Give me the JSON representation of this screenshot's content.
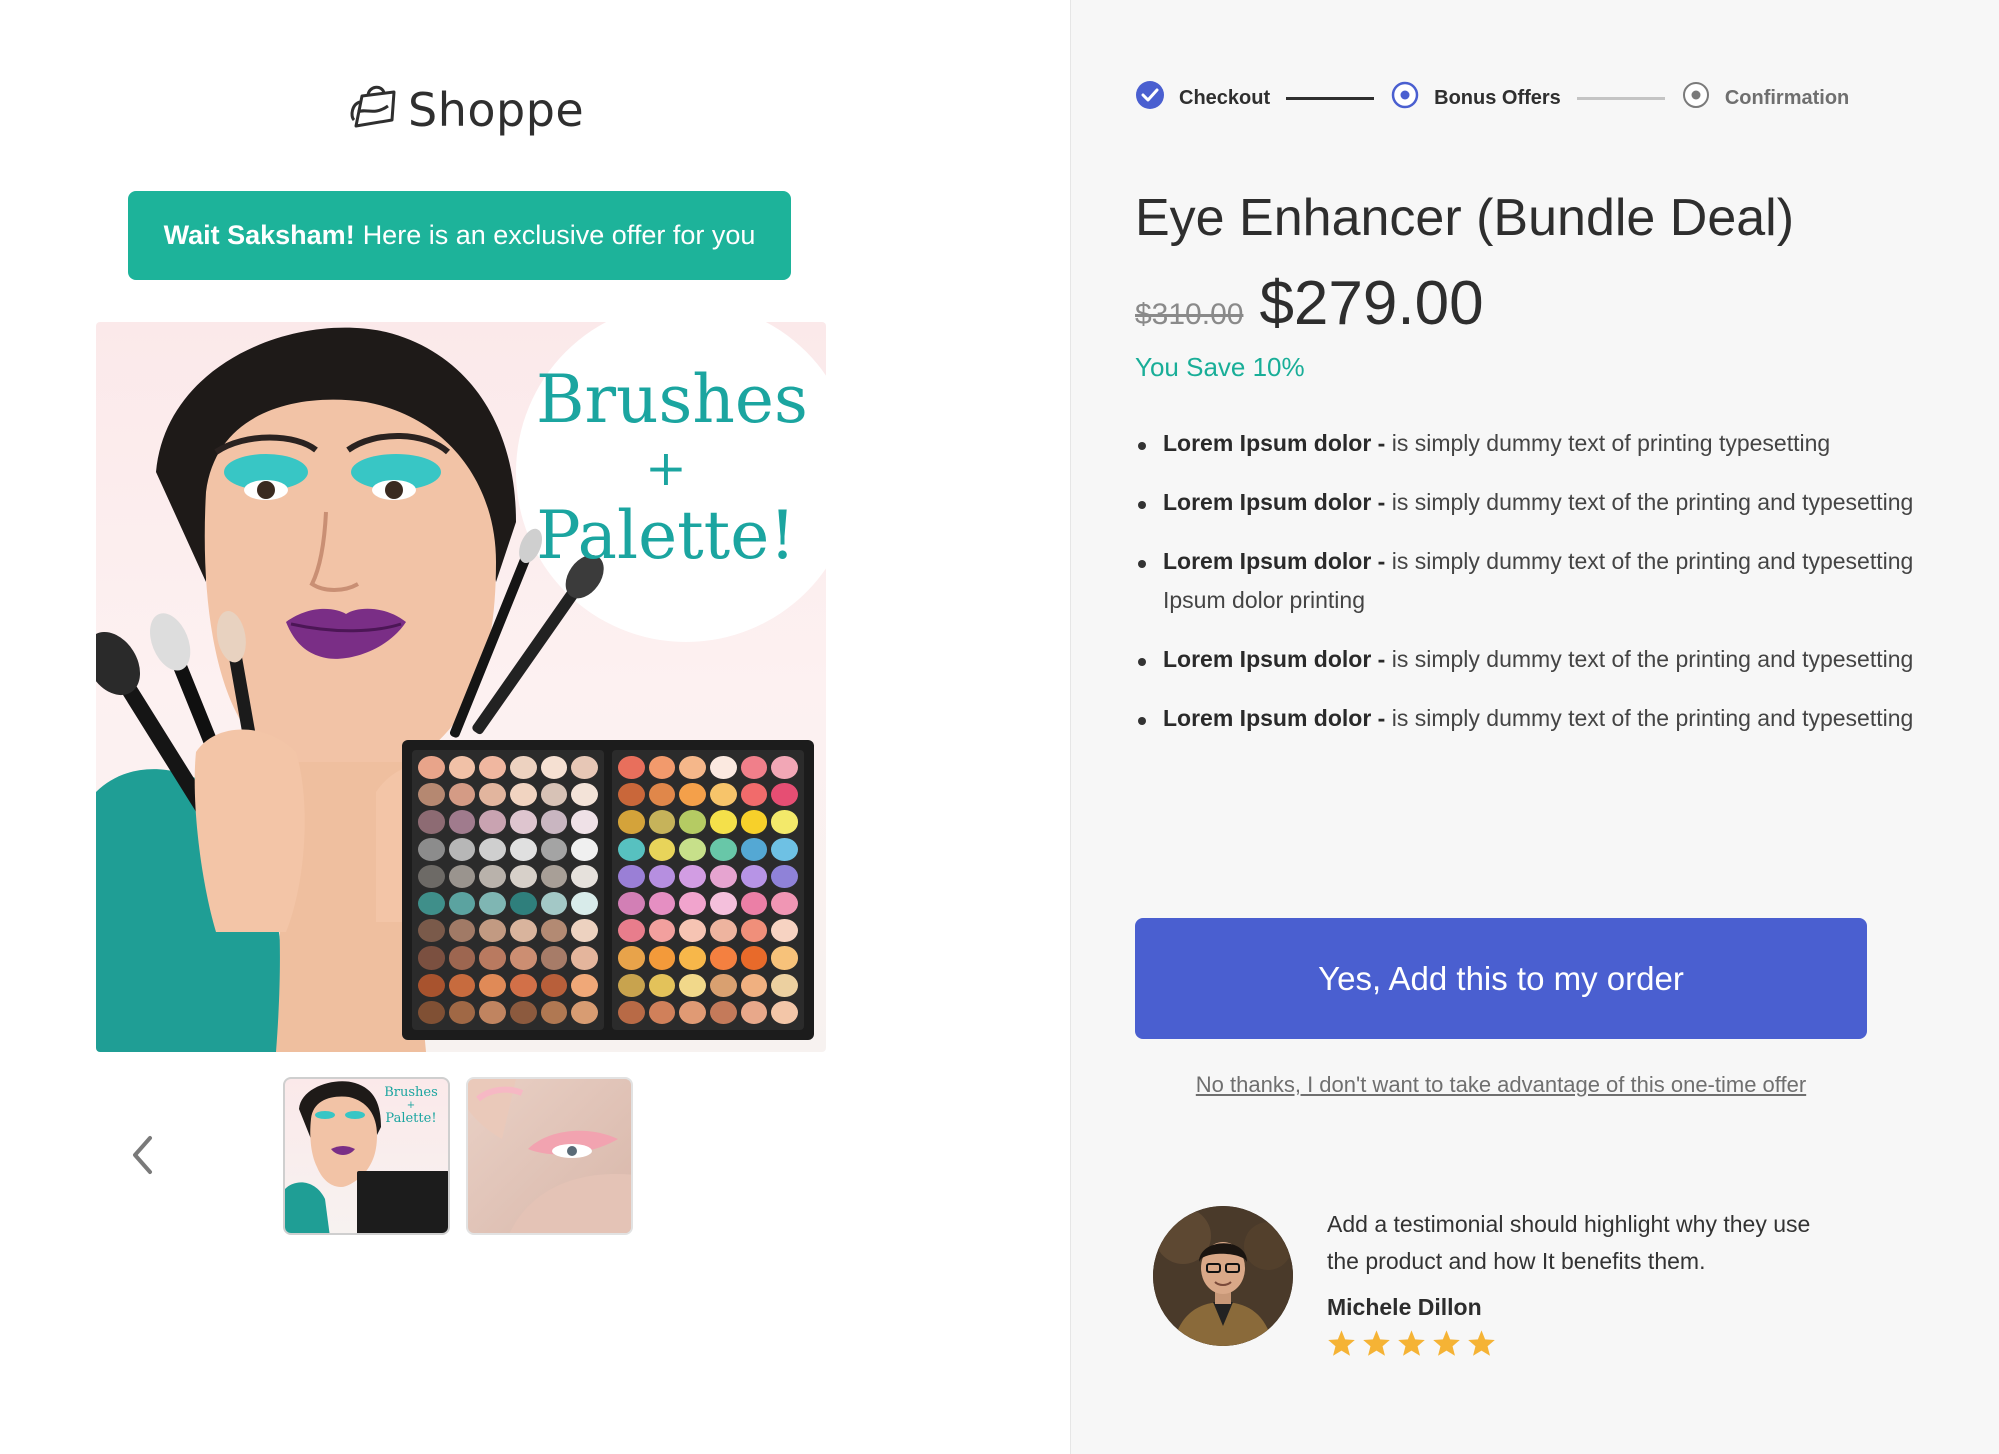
{
  "brand": {
    "name": "Shoppe",
    "icon": "shopping-bag-icon"
  },
  "banner": {
    "bold": "Wait Saksham!",
    "rest": "Here is an exclusive offer for you"
  },
  "hero": {
    "line1": "Brushes",
    "line2": "+",
    "line3": "Palette!"
  },
  "thumbnails": [
    {
      "line1": "Brushes",
      "line2": "+",
      "line3": "Palette!"
    },
    {}
  ],
  "steps": [
    {
      "label": "Checkout",
      "state": "done"
    },
    {
      "label": "Bonus Offers",
      "state": "current"
    },
    {
      "label": "Confirmation",
      "state": "upcoming"
    }
  ],
  "product": {
    "title": "Eye Enhancer (Bundle Deal)",
    "old_price": "$310.00",
    "new_price": "$279.00",
    "savings": "You Save 10%"
  },
  "features": [
    {
      "bold": "Lorem Ipsum dolor -",
      "text": " is simply dummy text of printing typesetting"
    },
    {
      "bold": "Lorem Ipsum dolor -",
      "text": " is simply dummy text of the printing and typesetting"
    },
    {
      "bold": "Lorem Ipsum dolor -",
      "text": " is simply dummy text of the printing and typesetting Ipsum dolor printing"
    },
    {
      "bold": "Lorem Ipsum dolor -",
      "text": " is simply dummy text of the printing and typesetting"
    },
    {
      "bold": "Lorem Ipsum dolor -",
      "text": " is simply dummy text of the printing and typesetting"
    }
  ],
  "cta": {
    "accept": "Yes, Add this to my order",
    "decline": "No thanks, I don't want to take advantage of this one-time offer"
  },
  "testimonial": {
    "quote": "Add a testimonial should highlight why they use the product and how It benefits them.",
    "name": "Michele Dillon",
    "rating": 5
  },
  "colors": {
    "accent": "#4a5fd0",
    "teal": "#1db39a",
    "star": "#f5b335"
  }
}
